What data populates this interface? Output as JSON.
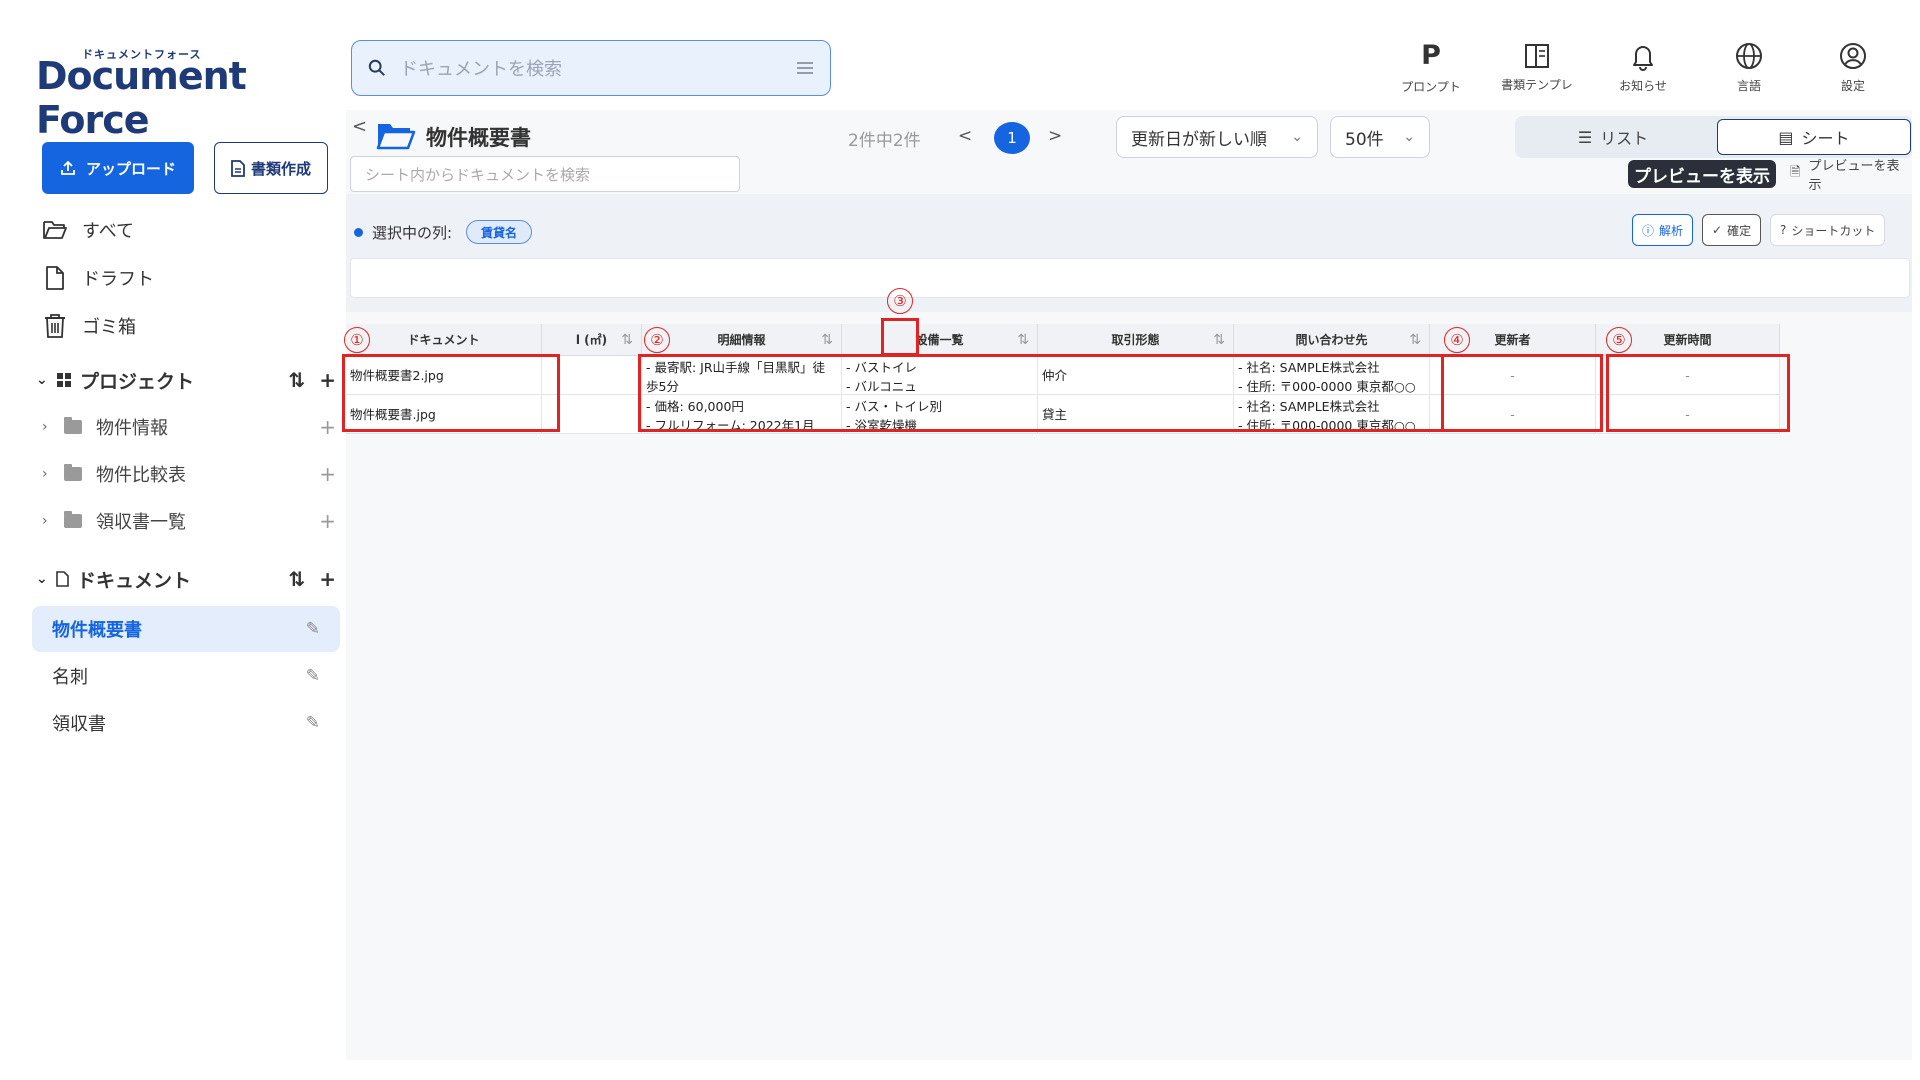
{
  "app": {
    "logo_kana": "ドキュメントフォース",
    "logo_text": "Document Force"
  },
  "search": {
    "placeholder": "ドキュメントを検索"
  },
  "topnav": [
    {
      "label": "プロンプト",
      "icon": "prompt-p-icon"
    },
    {
      "label": "書類テンプレ",
      "icon": "template-icon"
    },
    {
      "label": "お知らせ",
      "icon": "bell-icon"
    },
    {
      "label": "言語",
      "icon": "globe-icon"
    },
    {
      "label": "設定",
      "icon": "user-circle-icon"
    }
  ],
  "sidebar": {
    "upload_label": "アップロード",
    "create_label": "書類作成",
    "nav": [
      {
        "label": "すべて",
        "icon": "folder-open-icon"
      },
      {
        "label": "ドラフト",
        "icon": "file-icon"
      },
      {
        "label": "ゴミ箱",
        "icon": "trash-icon"
      }
    ],
    "project_section": "プロジェクト",
    "projects": [
      {
        "label": "物件情報"
      },
      {
        "label": "物件比較表"
      },
      {
        "label": "領収書一覧"
      }
    ],
    "document_section": "ドキュメント",
    "documents": [
      {
        "label": "物件概要書",
        "active": true
      },
      {
        "label": "名刺",
        "active": false
      },
      {
        "label": "領収書",
        "active": false
      }
    ]
  },
  "main": {
    "title": "物件概要書",
    "collapse_glyph": "<",
    "pager": {
      "count": "2件中2件",
      "prev": "<",
      "current": "1",
      "next": ">"
    },
    "sort_select": "更新日が新しい順",
    "per_page_select": "50件",
    "view_list": "リスト",
    "view_sheet": "シート",
    "sheet_search_placeholder": "シート内からドキュメントを検索",
    "preview_dark": "プレビューを表示",
    "preview_light": "プレビューを表示",
    "selected_label": "選択中の列:",
    "selected_chip": "賃貸名",
    "btn_analyze": "解析",
    "btn_confirm": "確定",
    "btn_shortcut": "ショートカット"
  },
  "table": {
    "headers": [
      "ドキュメント",
      "l (㎡)",
      "明細情報",
      "設備一覧",
      "取引形態",
      "問い合わせ先",
      "更新者",
      "更新時間"
    ],
    "rows": [
      {
        "doc": "物件概要書2.jpg",
        "area": "",
        "detail_1": "- 最寄駅: JR山手線「目黒駅」徒",
        "detail_2": "歩5分",
        "equip_1": "- バストイレ",
        "equip_2": "- バルコニュ",
        "trade": "仲介",
        "contact_1": "- 社名: SAMPLE株式会社",
        "contact_2": "- 住所: 〒000-0000 東京都○○",
        "updater": "-",
        "updated": "-"
      },
      {
        "doc": "物件概要書.jpg",
        "area": "",
        "detail_1": "- 価格: 60,000円",
        "detail_2": "- フルリフォーム: 2022年1月",
        "equip_1": "- バス・トイレ別",
        "equip_2": "- 浴室乾燥機",
        "trade": "貸主",
        "contact_1": "- 社名: SAMPLE株式会社",
        "contact_2": "- 住所: 〒000-0000 東京都○○",
        "updater": "-",
        "updated": "-"
      }
    ]
  },
  "annotations": [
    "①",
    "②",
    "③",
    "④",
    "⑤"
  ],
  "colors": {
    "accent": "#1565e0",
    "brand": "#1f3a78",
    "highlight": "#e02424"
  }
}
